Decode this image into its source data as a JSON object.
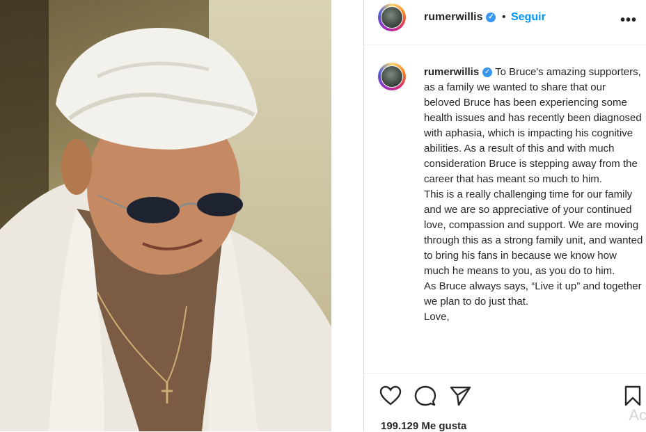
{
  "photo": {
    "alt": ""
  },
  "header": {
    "username": "rumerwillis",
    "separator": "•",
    "follow_label": "Seguir",
    "more_label": "•••"
  },
  "caption": {
    "username": "rumerwillis",
    "paragraphs": [
      "To Bruce's amazing supporters, as a family we wanted to share that our beloved Bruce has been experiencing some health issues and has recently been diagnosed with aphasia, which is impacting his cognitive abilities. As a result of this and with much consideration Bruce is stepping away from the career that has meant so much to him.",
      "This is a really challenging time for our family and we are so appreciative of your continued love, compassion and support. We are moving through this as a strong family unit, and wanted to bring his fans in because we know how much he means to you, as you do to him.",
      "As Bruce always says, “Live it up” and together we plan to do just that.",
      "Love,"
    ]
  },
  "actions": {
    "icons": [
      "heart-icon",
      "comment-icon",
      "share-icon",
      "bookmark-icon"
    ]
  },
  "likes_text": "199.129 Me gusta",
  "watermark": "Ac",
  "colors": {
    "accent": "#0095f6",
    "verified": "#3897f0",
    "text": "#262626"
  }
}
